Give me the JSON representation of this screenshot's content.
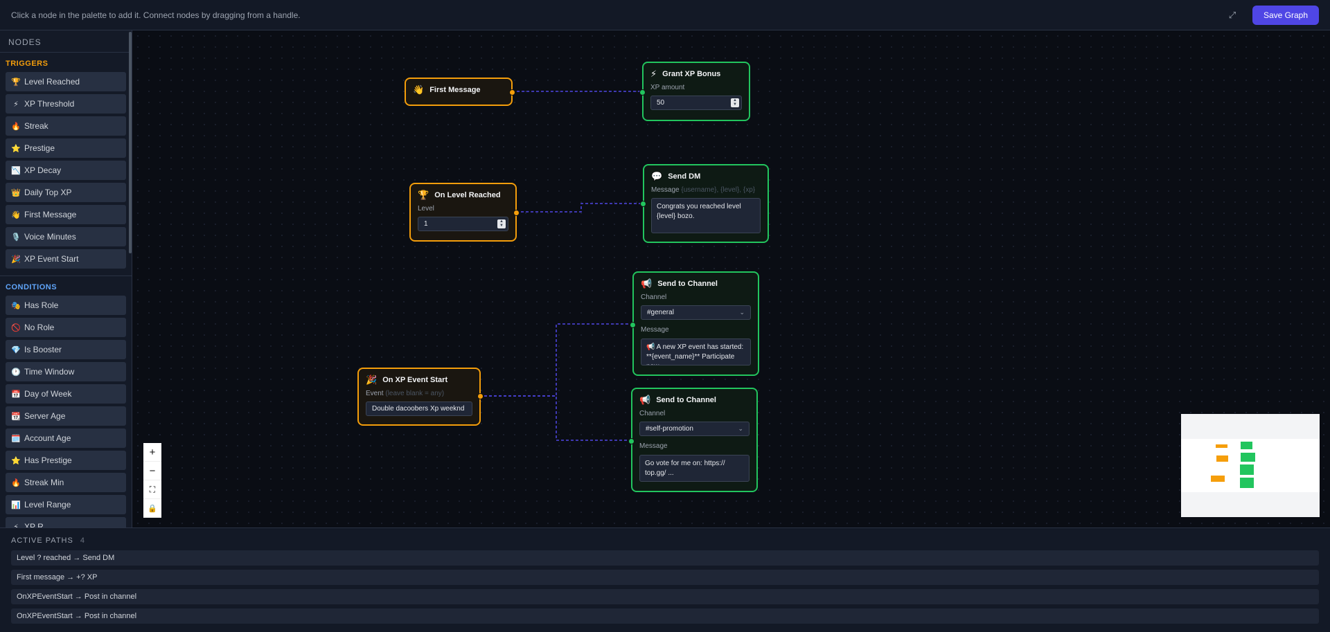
{
  "topbar": {
    "hint": "Click a node in the palette to add it. Connect nodes by dragging from a handle.",
    "save_label": "Save Graph",
    "expand_icon": "expand-icon"
  },
  "sidebar": {
    "title": "NODES",
    "triggers_label": "TRIGGERS",
    "conditions_label": "CONDITIONS",
    "triggers": [
      {
        "icon": "🏆",
        "label": "Level Reached"
      },
      {
        "icon": "⚡",
        "label": "XP Threshold"
      },
      {
        "icon": "🔥",
        "label": "Streak"
      },
      {
        "icon": "⭐",
        "label": "Prestige"
      },
      {
        "icon": "📉",
        "label": "XP Decay"
      },
      {
        "icon": "👑",
        "label": "Daily Top XP"
      },
      {
        "icon": "👋",
        "label": "First Message"
      },
      {
        "icon": "🎙️",
        "label": "Voice Minutes"
      },
      {
        "icon": "🎉",
        "label": "XP Event Start"
      }
    ],
    "conditions": [
      {
        "icon": "🎭",
        "label": "Has Role"
      },
      {
        "icon": "🚫",
        "label": "No Role"
      },
      {
        "icon": "💎",
        "label": "Is Booster"
      },
      {
        "icon": "🕐",
        "label": "Time Window"
      },
      {
        "icon": "📅",
        "label": "Day of Week"
      },
      {
        "icon": "📆",
        "label": "Server Age"
      },
      {
        "icon": "🗓️",
        "label": "Account Age"
      },
      {
        "icon": "⭐",
        "label": "Has Prestige"
      },
      {
        "icon": "🔥",
        "label": "Streak Min"
      },
      {
        "icon": "📊",
        "label": "Level Range"
      },
      {
        "icon": "⚡",
        "label": "XP R..."
      }
    ]
  },
  "nodes": {
    "first_message": {
      "icon": "👋",
      "title": "First Message"
    },
    "grant_xp": {
      "icon": "⚡",
      "title": "Grant XP Bonus",
      "field_label": "XP amount",
      "value": "50"
    },
    "on_level": {
      "icon": "🏆",
      "title": "On Level Reached",
      "field_label": "Level",
      "value": "1"
    },
    "send_dm": {
      "icon": "💬",
      "title": "Send DM",
      "field_label": "Message",
      "field_hint": "{username}, {level}, {xp}",
      "value": "Congrats you reached level {level} bozo."
    },
    "on_event": {
      "icon": "🎉",
      "title": "On XP Event Start",
      "field_label": "Event",
      "field_hint": "(leave blank = any)",
      "value": "Double dacoobers Xp weeknd"
    },
    "send_channel_1": {
      "icon": "📢",
      "title": "Send to Channel",
      "channel_label": "Channel",
      "channel": "#general",
      "message_label": "Message",
      "message": "📢 A new XP event has started: **{event_name}** Participate now..."
    },
    "send_channel_2": {
      "icon": "📢",
      "title": "Send to Channel",
      "channel_label": "Channel",
      "channel": "#self-promotion",
      "message_label": "Message",
      "message": "Go vote for me on: https:// top.gg/ ..."
    }
  },
  "controls": {
    "zoom_in": "+",
    "zoom_out": "−",
    "fit": "⛶",
    "lock": "🔒"
  },
  "active_paths": {
    "title": "ACTIVE PATHS",
    "count": "4",
    "items": [
      "Level ? reached → Send DM",
      "First message → +? XP",
      "OnXPEventStart → Post in channel",
      "OnXPEventStart → Post in channel"
    ]
  },
  "colors": {
    "trigger": "#f59e0b",
    "action": "#22c55e",
    "edge": "#4f46e5",
    "accent": "#4f46e5"
  }
}
